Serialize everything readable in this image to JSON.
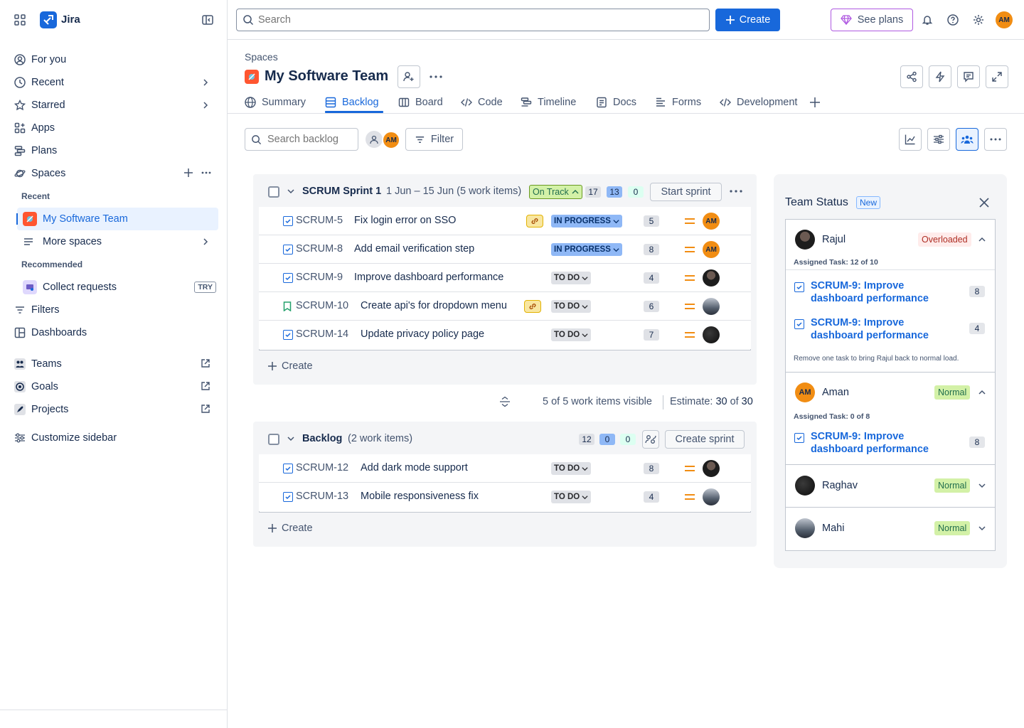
{
  "colors": {
    "accent": "#1868db",
    "brand": "#1868db",
    "warning_bg": "#ffeceb",
    "success_bg": "#d3f1a7"
  },
  "sidebar": {
    "app_name": "Jira",
    "items": [
      {
        "label": "For you",
        "icon": "user-circle-icon"
      },
      {
        "label": "Recent",
        "icon": "clock-icon"
      },
      {
        "label": "Starred",
        "icon": "star-icon"
      },
      {
        "label": "Apps",
        "icon": "apps-icon"
      },
      {
        "label": "Plans",
        "icon": "plans-icon"
      },
      {
        "label": "Spaces",
        "icon": "planet-icon"
      }
    ],
    "recent_heading": "Recent",
    "active_space": "My Software Team",
    "more_spaces": "More spaces",
    "recommended_heading": "Recommended",
    "collect_requests": "Collect requests",
    "try_badge": "TRY",
    "filters": "Filters",
    "dashboards": "Dashboards",
    "teams": "Teams",
    "goals": "Goals",
    "projects": "Projects",
    "customize": "Customize sidebar"
  },
  "topbar": {
    "search_placeholder": "Search",
    "create_label": "Create",
    "see_plans_label": "See plans",
    "user_initials": "AM"
  },
  "header": {
    "breadcrumb": "Spaces",
    "title": "My Software Team",
    "tabs": [
      "Summary",
      "Backlog",
      "Board",
      "Code",
      "Timeline",
      "Docs",
      "Forms",
      "Development"
    ],
    "active_tab": "Backlog"
  },
  "toolbar": {
    "search_placeholder": "Search backlog",
    "avatar_initials": "AM",
    "filter_label": "Filter"
  },
  "sprint": {
    "name": "SCRUM Sprint 1",
    "dates": "1 Jun – 15 Jun (5 work items)",
    "status": "On Track",
    "counts": [
      "17",
      "13",
      "0"
    ],
    "start_label": "Start sprint",
    "items": [
      {
        "key": "SCRUM-5",
        "summary": "Fix login error on SSO",
        "status": "IN PROGRESS",
        "points": "5",
        "type": "task",
        "linked": true,
        "assignee": "AM"
      },
      {
        "key": "SCRUM-8",
        "summary": "Add email verification step",
        "status": "IN PROGRESS",
        "points": "8",
        "type": "task",
        "linked": false,
        "assignee": "AM"
      },
      {
        "key": "SCRUM-9",
        "summary": "Improve dashboard performance",
        "status": "TO DO",
        "points": "4",
        "type": "task",
        "linked": false,
        "assignee": "dark"
      },
      {
        "key": "SCRUM-10",
        "summary": "Create api's for dropdown menu",
        "status": "TO DO",
        "points": "6",
        "type": "story",
        "linked": true,
        "assignee": "photo"
      },
      {
        "key": "SCRUM-14",
        "summary": "Update privacy policy page",
        "status": "TO DO",
        "points": "7",
        "type": "task",
        "linked": false,
        "assignee": "space"
      }
    ],
    "create_label": "Create"
  },
  "summary_line": {
    "visible": "5 of 5 work items visible",
    "estimate_label": "Estimate:",
    "estimate_value": "30",
    "estimate_of": "of",
    "estimate_total": "30"
  },
  "backlog": {
    "name": "Backlog",
    "count_text": "(2 work items)",
    "counts": [
      "12",
      "0",
      "0"
    ],
    "create_sprint_label": "Create sprint",
    "items": [
      {
        "key": "SCRUM-12",
        "summary": "Add dark mode support",
        "status": "TO DO",
        "points": "8",
        "assignee": "dark"
      },
      {
        "key": "SCRUM-13",
        "summary": "Mobile responsiveness fix",
        "status": "TO DO",
        "points": "4",
        "assignee": "photo"
      }
    ],
    "create_label": "Create"
  },
  "team_status": {
    "title": "Team Status",
    "new_badge": "New",
    "members": [
      {
        "name": "Rajul",
        "status": "Overloaded",
        "assigned": "Assigned Task: 12 of 10",
        "tasks": [
          {
            "title": "SCRUM-9: Improve dashboard performance",
            "points": "8"
          },
          {
            "title": "SCRUM-9: Improve dashboard performance",
            "points": "4"
          }
        ],
        "note": "Remove one task to bring Rajul back to normal load."
      },
      {
        "name": "Aman",
        "initials": "AM",
        "status": "Normal",
        "assigned": "Assigned Task: 0 of 8",
        "tasks": [
          {
            "title": "SCRUM-9: Improve dashboard performance",
            "points": "8"
          }
        ]
      },
      {
        "name": "Raghav",
        "status": "Normal"
      },
      {
        "name": "Mahi",
        "status": "Normal"
      }
    ]
  }
}
